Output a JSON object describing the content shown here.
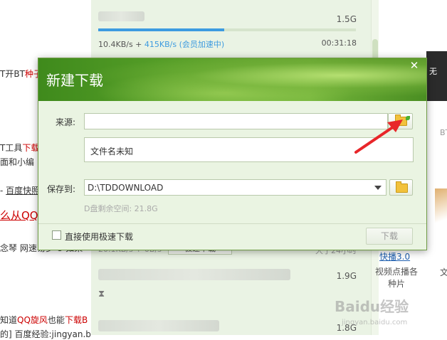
{
  "left_article": {
    "l1_pre": "T开BT",
    "l1_red": "种子",
    "l2_pre": "T工具",
    "l2_red": "下载",
    "l3": "面和小编",
    "l4_pre": "- ",
    "l4_link": "百度快照",
    "l5_red": "么从QQ",
    "l6": "念琴 网速易罗 U 如果",
    "l7_pre": "知道",
    "l7_red": "QQ旋风",
    "l7_mid": "也能",
    "l7_red2": "下载B",
    "l8": "的] 百度经验:jingyan.b"
  },
  "download_list": {
    "task1": {
      "size": "1.5G",
      "progress": 0.49,
      "speed": "10.4KB/s + ",
      "accel": "415KB/s (会员加速中)",
      "remaining": "00:31:18"
    },
    "task2_partial": {
      "speed": "20.1KB/s + 0B/s",
      "button": "极速下载",
      "remaining": "大于24小时"
    },
    "task3": {
      "size": "1.9G",
      "status_icon": "hourglass-icon"
    },
    "task4": {
      "size": "1.8G"
    }
  },
  "right_panel": {
    "banner_text": "无",
    "bt_label": "BT",
    "kuaibo_link": "快播3.0",
    "kuaibo_desc": "视频点播各种片",
    "wen": "文"
  },
  "dialog": {
    "title": "新建下载",
    "source_label": "来源:",
    "source_value": "",
    "filename": "文件名未知",
    "save_label": "保存到:",
    "save_path": "D:\\TDDOWNLOAD",
    "free_space": "D盘剩余空间: 21.8G",
    "checkbox_label": "直接使用极速下载",
    "checkbox_checked": false,
    "download_button": "下载",
    "close_icon": "close-icon",
    "colors": {
      "header_green": "#5aa22a",
      "body_bg": "#eaf4e2",
      "accent_blue": "#3d9be0"
    }
  },
  "annotation": {
    "arrow_color": "#e8262a"
  },
  "watermark": {
    "text": "Baidu经验",
    "sub": "jingyan.baidu.com"
  }
}
